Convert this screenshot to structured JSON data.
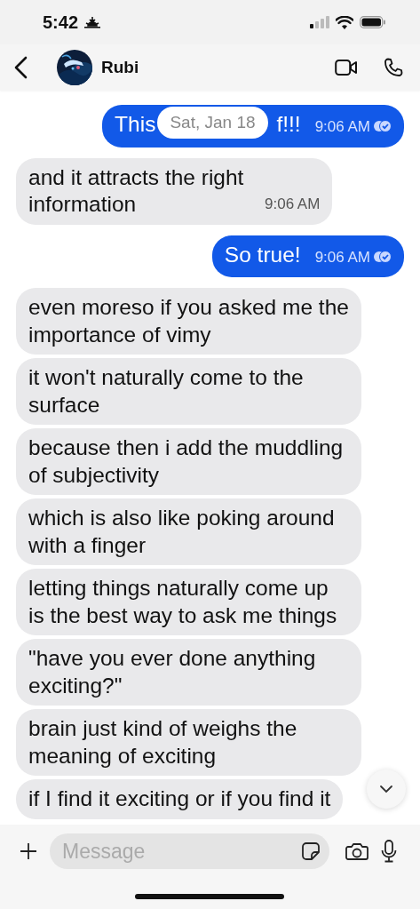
{
  "status_bar": {
    "time": "5:42"
  },
  "header": {
    "contact_name": "Rubi"
  },
  "date_chip": "Sat, Jan 18",
  "messages": [
    {
      "outgoing": true,
      "text_parts": [
        "This",
        "f!!!"
      ],
      "time": "9:06 AM",
      "read": true
    },
    {
      "outgoing": false,
      "text": "and it attracts the right information",
      "time": "9:06 AM"
    },
    {
      "outgoing": true,
      "text": "So true!",
      "time": "9:06 AM",
      "read": true
    },
    {
      "outgoing": false,
      "text": "even moreso if you asked me the importance of vimy"
    },
    {
      "outgoing": false,
      "text": "it won't naturally come to the surface"
    },
    {
      "outgoing": false,
      "text": "because then i add the muddling of subjectivity"
    },
    {
      "outgoing": false,
      "text": "which is also like poking around with a finger"
    },
    {
      "outgoing": false,
      "text": "letting things naturally come up is the best way to ask me things"
    },
    {
      "outgoing": false,
      "text": "\"have you ever done anything exciting?\""
    },
    {
      "outgoing": false,
      "text": "brain just kind of weighs the meaning of exciting"
    },
    {
      "outgoing": false,
      "text": "if I find it exciting or if you find it"
    }
  ],
  "composer": {
    "placeholder": "Message"
  }
}
